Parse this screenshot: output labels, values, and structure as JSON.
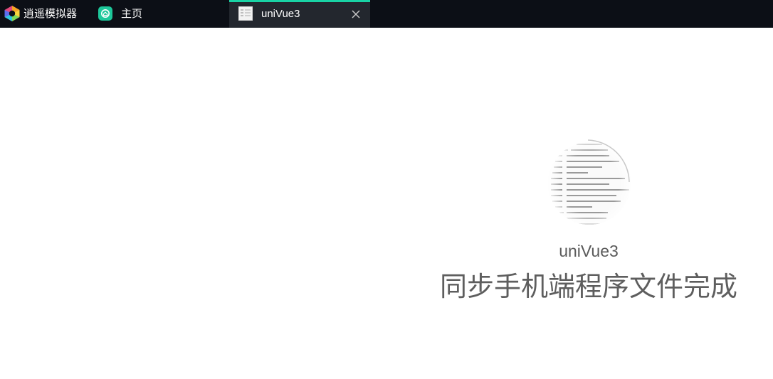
{
  "titlebar": {
    "app_title": "逍遥模拟器",
    "tabs": [
      {
        "label": "主页",
        "icon": "home-icon",
        "active": false
      },
      {
        "label": "uniVue3",
        "icon": "document-icon",
        "active": true
      }
    ],
    "close_icon": "close-icon"
  },
  "colors": {
    "titlebar_bg": "#0c0f16",
    "active_tab_bg": "#23272e",
    "accent": "#19d3a5",
    "home_icon_bg": "#1dc79a",
    "text_gray": "#5e5e5e"
  },
  "splash": {
    "app_name": "uniVue3",
    "status": "同步手机端程序文件完成",
    "icon": "app-splash-icon"
  }
}
